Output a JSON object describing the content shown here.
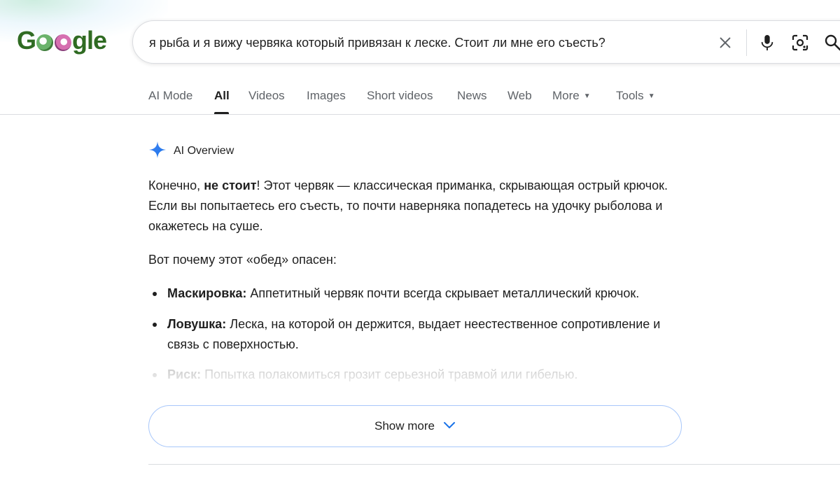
{
  "logo": {
    "text_left": "G",
    "text_right": "gle"
  },
  "search": {
    "query": "я рыба и я вижу червяка который привязан к леске. Стоит ли мне его съесть?"
  },
  "icons": {
    "clear": "close-icon",
    "voice": "microphone-icon",
    "lens": "camera-lens-icon",
    "search": "search-icon",
    "ai": "sparkle-icon",
    "expand": "chevron-down-icon"
  },
  "tabs": [
    {
      "label": "AI Mode"
    },
    {
      "label": "All",
      "active": true
    },
    {
      "label": "Videos"
    },
    {
      "label": "Images"
    },
    {
      "label": "Short videos"
    },
    {
      "label": "News"
    },
    {
      "label": "Web"
    },
    {
      "label": "More"
    },
    {
      "label": "Tools"
    }
  ],
  "ai_overview": {
    "title": "AI Overview",
    "intro_pre": "Конечно, ",
    "intro_bold": "не стоит",
    "intro_post": "! Этот червяк — классическая приманка, скрывающая острый крючок. Если вы попытаетесь его съесть, то почти наверняка попадетесь на удочку рыболова и окажетесь на суше.",
    "lead": "Вот почему этот «обед» опасен:",
    "bullets": [
      {
        "term": "Маскировка:",
        "text": " Аппетитный червяк почти всегда скрывает металлический крючок."
      },
      {
        "term": "Ловушка:",
        "text": " Леска, на которой он держится, выдает неестественное сопротивление и связь с поверхностью."
      },
      {
        "term": "Риск:",
        "text": " Попытка полакомиться грозит серьезной травмой или гибелью."
      }
    ],
    "show_more": "Show more"
  },
  "colors": {
    "accent_blue": "#4285f4",
    "logo_green": "#2f6b22",
    "text_primary": "#1f1f1f",
    "text_secondary": "#5f6368",
    "border": "#dadce0",
    "show_more_border": "#a8c7fa"
  }
}
